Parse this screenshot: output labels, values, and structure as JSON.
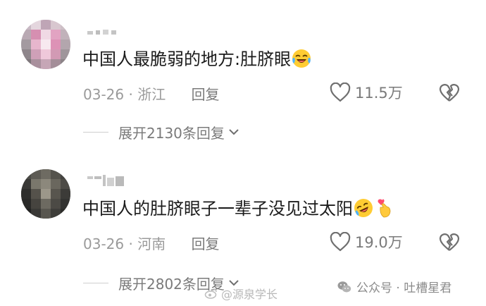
{
  "comments": [
    {
      "text": "中国人最脆弱的地方:肚脐眼",
      "emoji_icon": "laughing-tears-emoji",
      "date": "03-26",
      "region": "浙江",
      "separator": " · ",
      "reply_label": "回复",
      "likes": "11.5万",
      "expand_label": "展开2130条回复"
    },
    {
      "text": "中国人的肚脐眼子一辈子没见过太阳",
      "emoji_icon": "rofl-emoji",
      "emoji2_icon": "finger-heart-emoji",
      "date": "03-26",
      "region": "河南",
      "separator": " · ",
      "reply_label": "回复",
      "likes": "19.0万",
      "expand_label": "展开2802条回复"
    }
  ],
  "watermark": {
    "text": "公众号 · 吐槽星君",
    "icon": "wechat-icon"
  },
  "weibo_watermark": {
    "text": "@源泉学长",
    "icon": "weibo-icon"
  },
  "colors": {
    "text": "#1b1b1b",
    "meta": "#9a9a9a",
    "action": "#7a7a7a"
  }
}
